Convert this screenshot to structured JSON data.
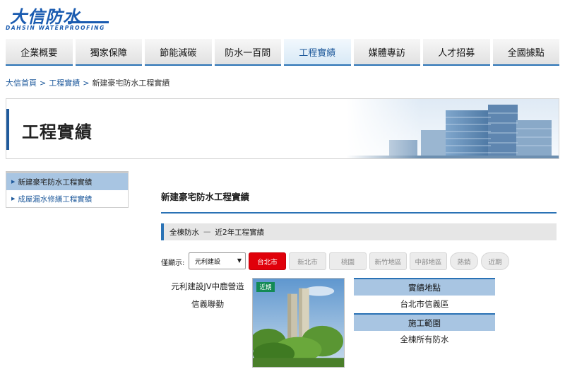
{
  "logo": {
    "name_cn": "大信防水",
    "name_en": "DAHSIN WATERPROOFING"
  },
  "nav": [
    {
      "label": "企業概要"
    },
    {
      "label": "獨家保障"
    },
    {
      "label": "節能減碳"
    },
    {
      "label": "防水一百問"
    },
    {
      "label": "工程實績",
      "active": true
    },
    {
      "label": "媒體專訪"
    },
    {
      "label": "人才招募"
    },
    {
      "label": "全國據點"
    }
  ],
  "breadcrumb": {
    "home": "大信首頁",
    "section": "工程實績",
    "current": "新建豪宅防水工程實績"
  },
  "banner": {
    "title": "工程實績"
  },
  "sidebar": {
    "items": [
      {
        "label": "新建豪宅防水工程實績",
        "active": true
      },
      {
        "label": "成屋漏水修繕工程實績"
      }
    ]
  },
  "main": {
    "title": "新建豪宅防水工程實績",
    "subhead": {
      "left": "全棟防水",
      "right": "近2年工程實績"
    },
    "filter": {
      "label": "僅顯示:",
      "select_value": "元利建設",
      "chips": [
        {
          "label": "台北市",
          "active": true
        },
        {
          "label": "新北市"
        },
        {
          "label": "桃園"
        },
        {
          "label": "新竹地區"
        },
        {
          "label": "中部地區"
        },
        {
          "label": "熱銷"
        },
        {
          "label": "近期"
        }
      ]
    },
    "project": {
      "builder": "元利建設JV中鹿營造",
      "name": "信義聯勤",
      "badge": "近期",
      "location_label": "實績地點",
      "location_value": "台北市信義區",
      "scope_label": "施工範圍",
      "scope_value": "全棟所有防水"
    }
  },
  "colors": {
    "brand_blue": "#1a5bb0",
    "nav_accent": "#2a72b5",
    "active_chip": "#e0000a",
    "badge_green": "#138a55",
    "info_header": "#a8c5e2"
  }
}
